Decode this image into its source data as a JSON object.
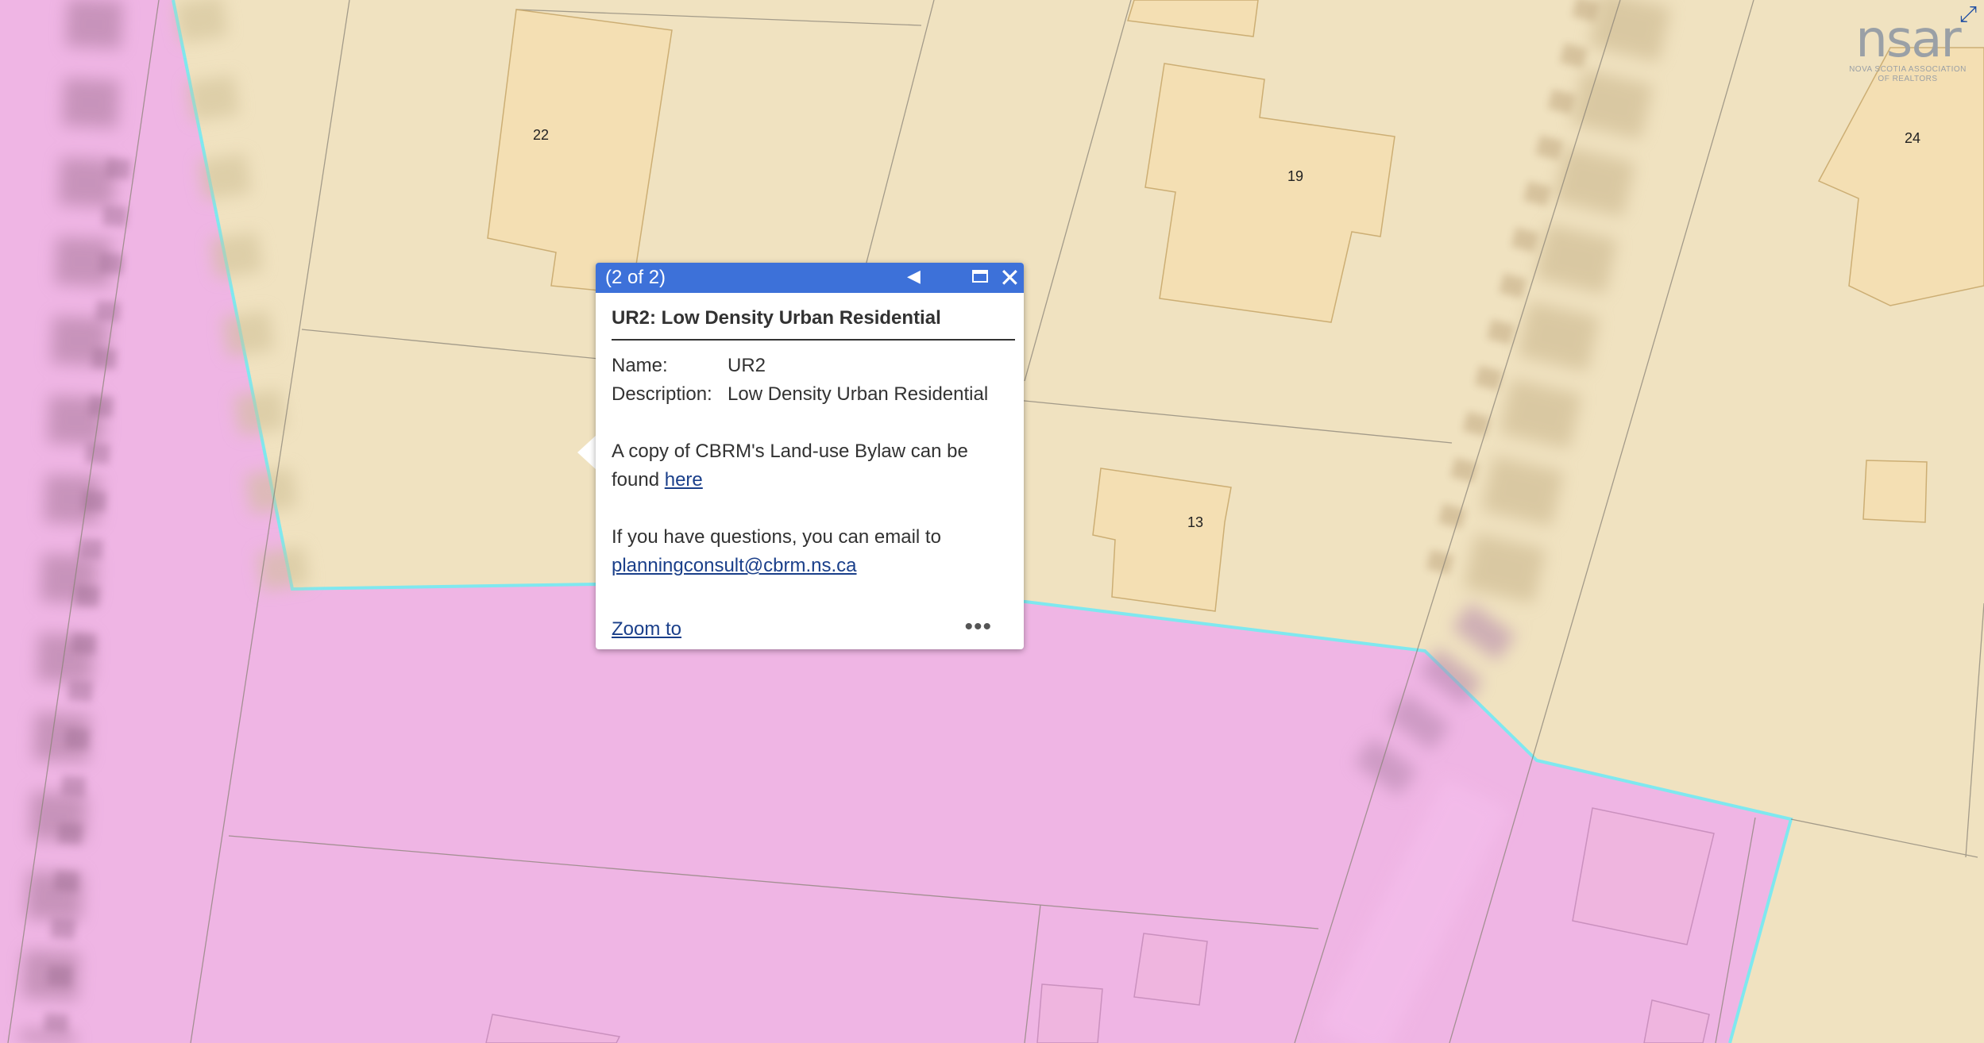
{
  "map": {
    "lot_numbers": [
      "22",
      "19",
      "24",
      "13"
    ],
    "zone_colors": {
      "residential": "#f0e2c0",
      "pink_zone": "#efb5e4",
      "boundary": "#7fe8ef"
    }
  },
  "logo": {
    "text": "nsar",
    "subtitle": "NOVA SCOTIA ASSOCIATION OF REALTORS"
  },
  "popup": {
    "count": "(2 of 2)",
    "title": "UR2: Low Density Urban Residential",
    "fields": [
      {
        "key": "Name:",
        "value": "UR2"
      },
      {
        "key": "Description:",
        "value": "Low Density Urban Residential"
      }
    ],
    "bylaw_text": "A copy of CBRM's Land-use Bylaw can be found",
    "bylaw_link": "here",
    "email_text": "If you have questions, you can email to",
    "email_link": "planningconsult@cbrm.ns.ca",
    "zoom_label": "Zoom to",
    "more_label": "•••"
  },
  "icons": {
    "prev": "previous-arrow-icon",
    "maximize": "maximize-icon",
    "close": "close-icon",
    "expand": "expand-icon"
  }
}
